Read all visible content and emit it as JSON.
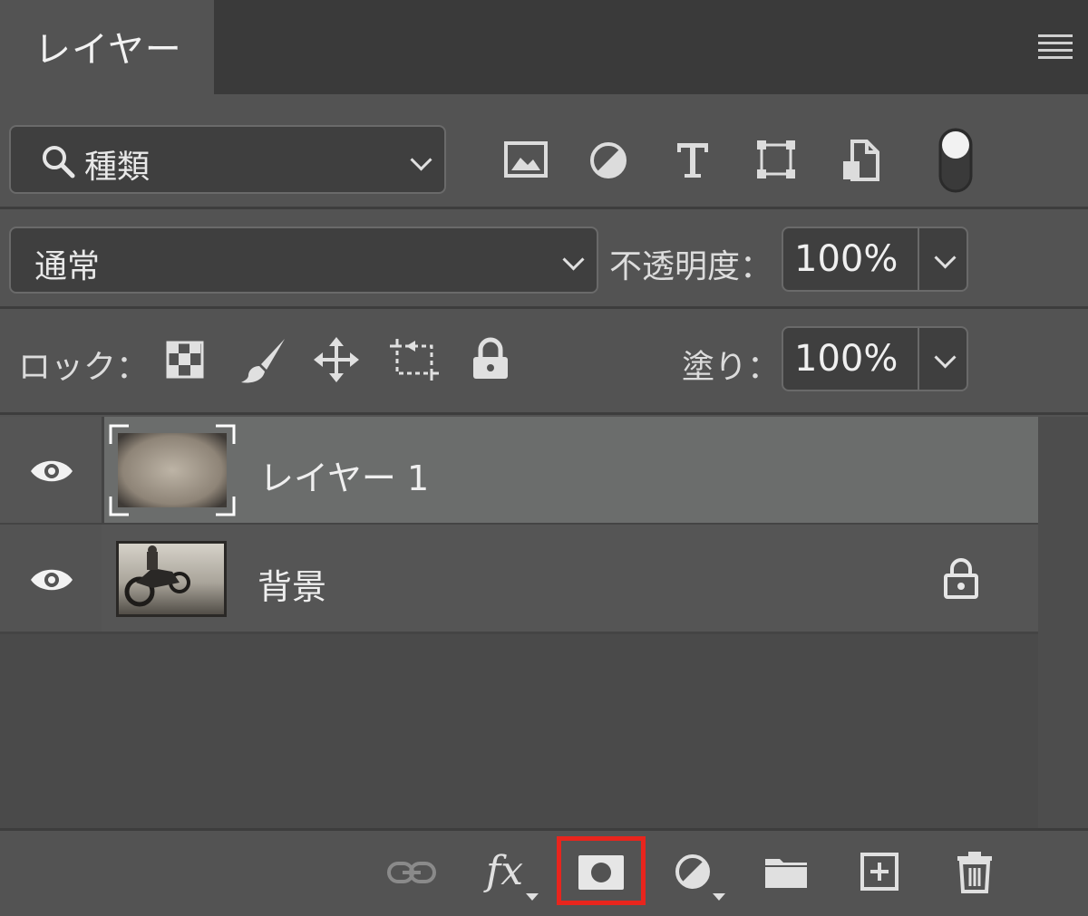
{
  "panel": {
    "tab_title": "レイヤー",
    "menu_icon": "panel-menu-icon"
  },
  "filter": {
    "kind_label": "種類",
    "icons": [
      "search-icon",
      "image-filter-icon",
      "adjustment-filter-icon",
      "text-filter-icon",
      "shape-filter-icon",
      "smart-object-filter-icon",
      "filter-toggle-icon"
    ]
  },
  "blend": {
    "mode": "通常",
    "opacity_label": "不透明度：",
    "opacity_value": "100%"
  },
  "lock": {
    "label": "ロック：",
    "icons": [
      "lock-transparent-icon",
      "lock-image-icon",
      "lock-position-icon",
      "lock-artboard-icon",
      "lock-all-icon"
    ],
    "fill_label": "塗り：",
    "fill_value": "100%"
  },
  "layers": [
    {
      "name": "レイヤー 1",
      "visible": true,
      "selected": true,
      "locked": false
    },
    {
      "name": "背景",
      "visible": true,
      "selected": false,
      "locked": true
    }
  ],
  "bottom_toolbar": {
    "icons": [
      "link-layers-icon",
      "fx-icon",
      "add-mask-icon",
      "adjustment-layer-icon",
      "new-group-icon",
      "new-layer-icon",
      "delete-icon"
    ],
    "fx_text": "fx",
    "highlighted": "add-mask-icon",
    "highlight_color": "#e8251d"
  },
  "colors": {
    "panel_bg": "#535353",
    "selected_row": "#6b6d6c"
  }
}
